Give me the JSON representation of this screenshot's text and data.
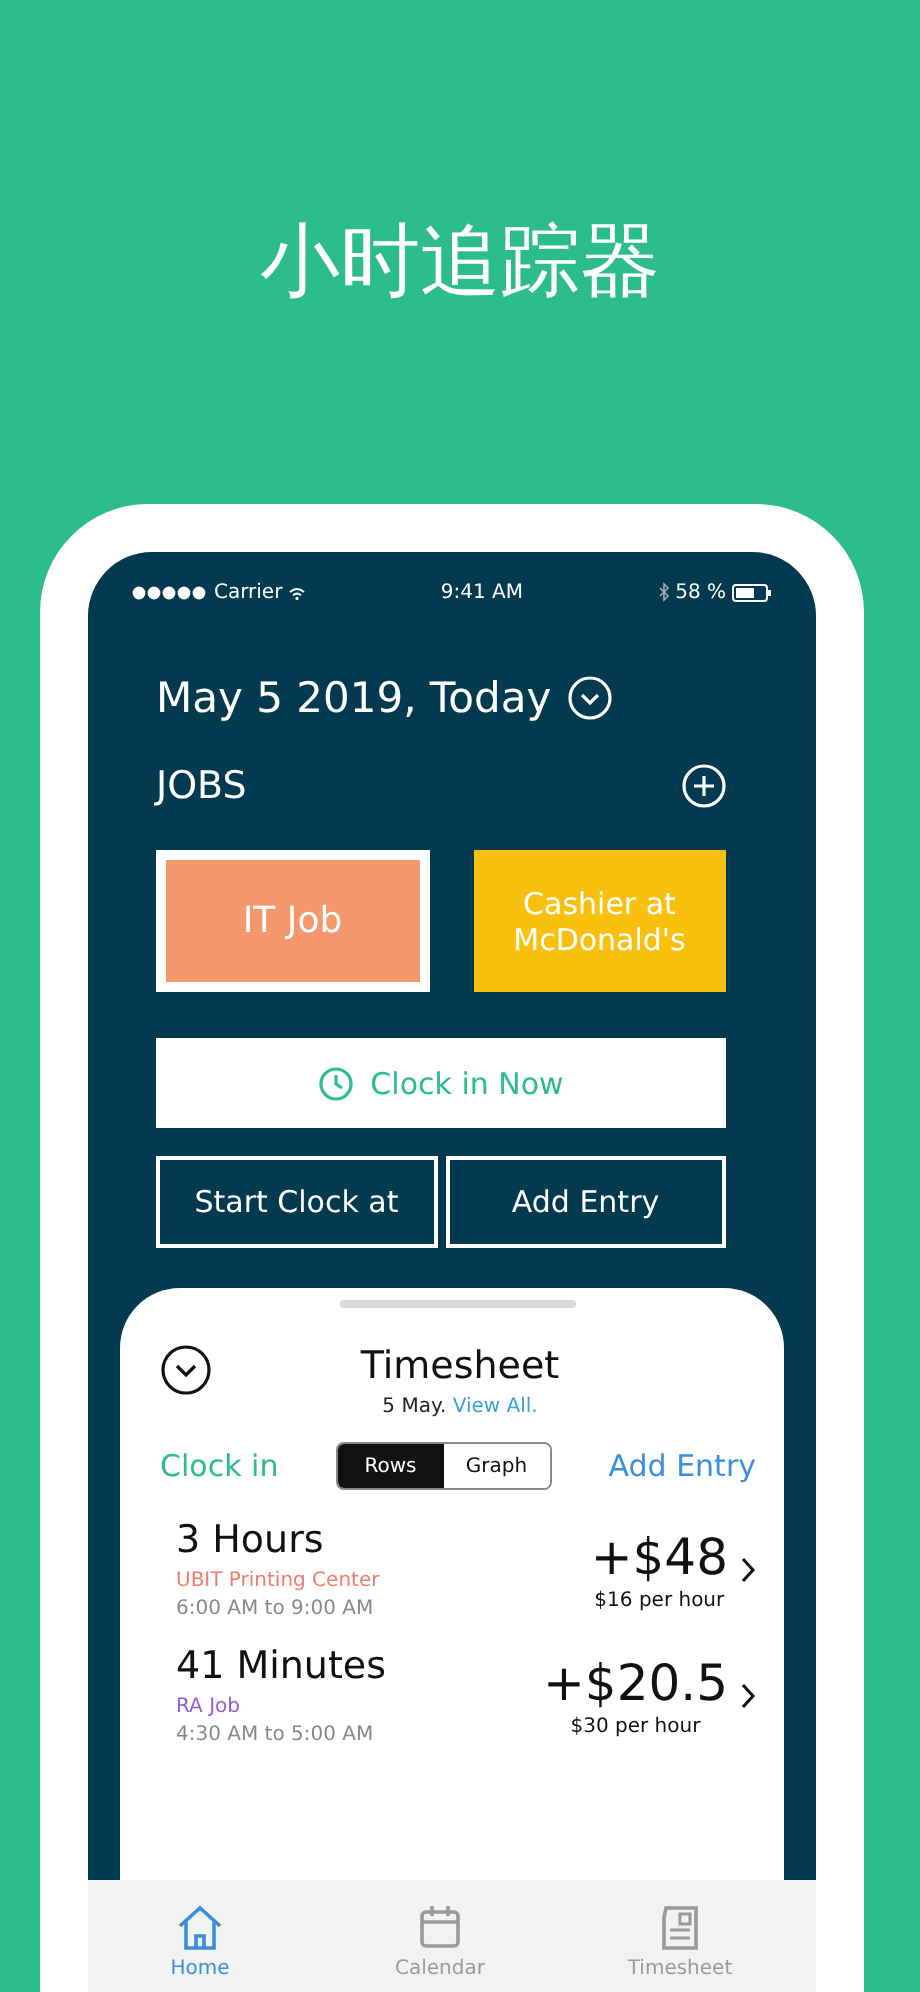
{
  "headline": "小时追踪器",
  "status_bar": {
    "carrier": "Carrier",
    "time": "9:41 AM",
    "battery": "58 %"
  },
  "date": "May 5 2019, Today",
  "jobs_title": "JOBS",
  "jobs": [
    {
      "name": "IT Job",
      "color": "#f4976c",
      "selected": true
    },
    {
      "name": "Cashier at McDonald's",
      "color": "#f9c10d",
      "selected": false
    }
  ],
  "clock_in_button": "Clock in Now",
  "buttons": [
    "Start Clock at",
    "Add Entry"
  ],
  "timesheet": {
    "title": "Timesheet",
    "date": "5 May.",
    "view_all": "View All.",
    "clock_in": "Clock in",
    "view_options": [
      {
        "label": "Rows",
        "selected": true
      },
      {
        "label": "Graph",
        "selected": false
      }
    ],
    "add_entry": "Add Entry",
    "entries": [
      {
        "duration": "3 Hours",
        "job": "UBIT Printing Center",
        "color": "#f07b6e",
        "time_range": "6:00 AM to 9:00 AM",
        "amount": "+$48",
        "rate": "$16 per hour"
      },
      {
        "duration": "41 Minutes",
        "job": "RA Job",
        "color": "#9b5bd6",
        "time_range": "4:30 AM to 5:00 AM",
        "amount": "+$20.5",
        "rate": "$30 per hour"
      }
    ]
  },
  "tab_bar": [
    {
      "label": "Home",
      "selected": true
    },
    {
      "label": "Calendar",
      "selected": false
    },
    {
      "label": "Timesheet",
      "selected": false
    }
  ]
}
